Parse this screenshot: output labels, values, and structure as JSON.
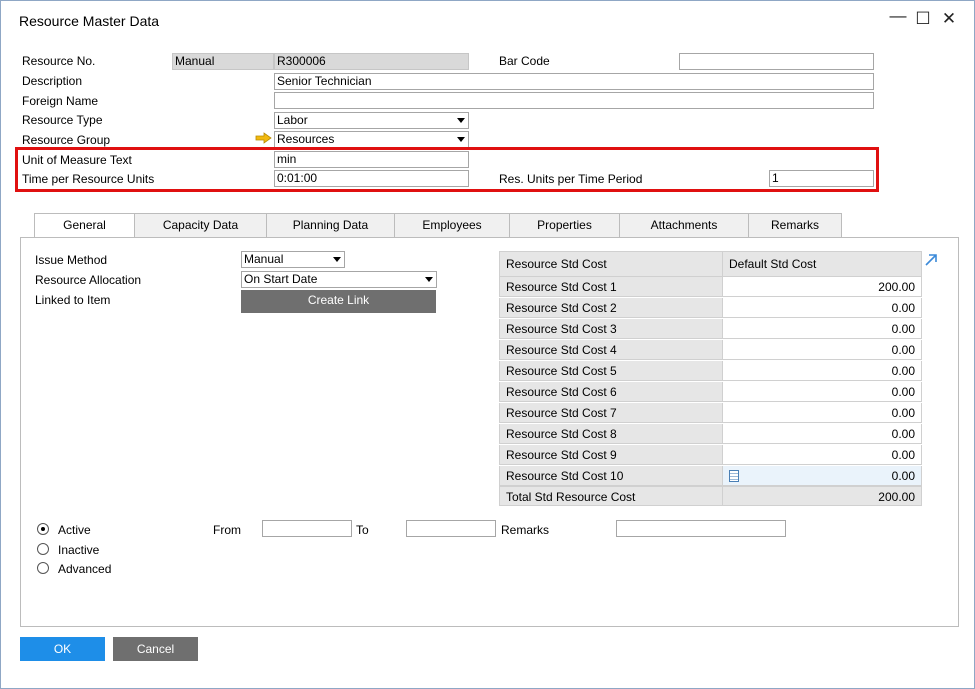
{
  "window": {
    "title": "Resource Master Data"
  },
  "header": {
    "resource_no": {
      "label": "Resource No.",
      "series": "Manual",
      "value": "R300006"
    },
    "bar_code": {
      "label": "Bar Code",
      "value": ""
    },
    "description": {
      "label": "Description",
      "value": "Senior Technician"
    },
    "foreign_name": {
      "label": "Foreign Name",
      "value": ""
    },
    "resource_type": {
      "label": "Resource Type",
      "value": "Labor"
    },
    "resource_group": {
      "label": "Resource Group",
      "value": "Resources"
    },
    "uom_text": {
      "label": "Unit of Measure Text",
      "value": "min"
    },
    "time_per_unit": {
      "label": "Time per Resource Units",
      "value": "0:01:00"
    },
    "units_per_period": {
      "label": "Res. Units per Time Period",
      "value": "1"
    }
  },
  "tabs": [
    {
      "label": "General"
    },
    {
      "label": "Capacity Data"
    },
    {
      "label": "Planning Data"
    },
    {
      "label": "Employees"
    },
    {
      "label": "Properties"
    },
    {
      "label": "Attachments"
    },
    {
      "label": "Remarks"
    }
  ],
  "general": {
    "issue_method": {
      "label": "Issue Method",
      "value": "Manual"
    },
    "resource_allocation": {
      "label": "Resource Allocation",
      "value": "On Start Date"
    },
    "linked_to_item": {
      "label": "Linked to Item",
      "button": "Create Link"
    }
  },
  "cost_grid": {
    "headers": [
      "Resource Std Cost",
      "Default Std Cost"
    ],
    "rows": [
      {
        "name": "Resource Std Cost 1",
        "value": "200.00"
      },
      {
        "name": "Resource Std Cost 2",
        "value": "0.00"
      },
      {
        "name": "Resource Std Cost 3",
        "value": "0.00"
      },
      {
        "name": "Resource Std Cost 4",
        "value": "0.00"
      },
      {
        "name": "Resource Std Cost 5",
        "value": "0.00"
      },
      {
        "name": "Resource Std Cost 6",
        "value": "0.00"
      },
      {
        "name": "Resource Std Cost 7",
        "value": "0.00"
      },
      {
        "name": "Resource Std Cost 8",
        "value": "0.00"
      },
      {
        "name": "Resource Std Cost 9",
        "value": "0.00"
      },
      {
        "name": "Resource Std Cost 10",
        "value": "0.00"
      }
    ],
    "total": {
      "name": "Total Std Resource Cost",
      "value": "200.00"
    }
  },
  "status": {
    "options": [
      "Active",
      "Inactive",
      "Advanced"
    ],
    "selected": "Active",
    "from_label": "From",
    "to_label": "To",
    "remarks_label": "Remarks"
  },
  "footer": {
    "ok": "OK",
    "cancel": "Cancel"
  },
  "colors": {
    "accent": "#1e8ee8",
    "highlight": "#e01010"
  }
}
